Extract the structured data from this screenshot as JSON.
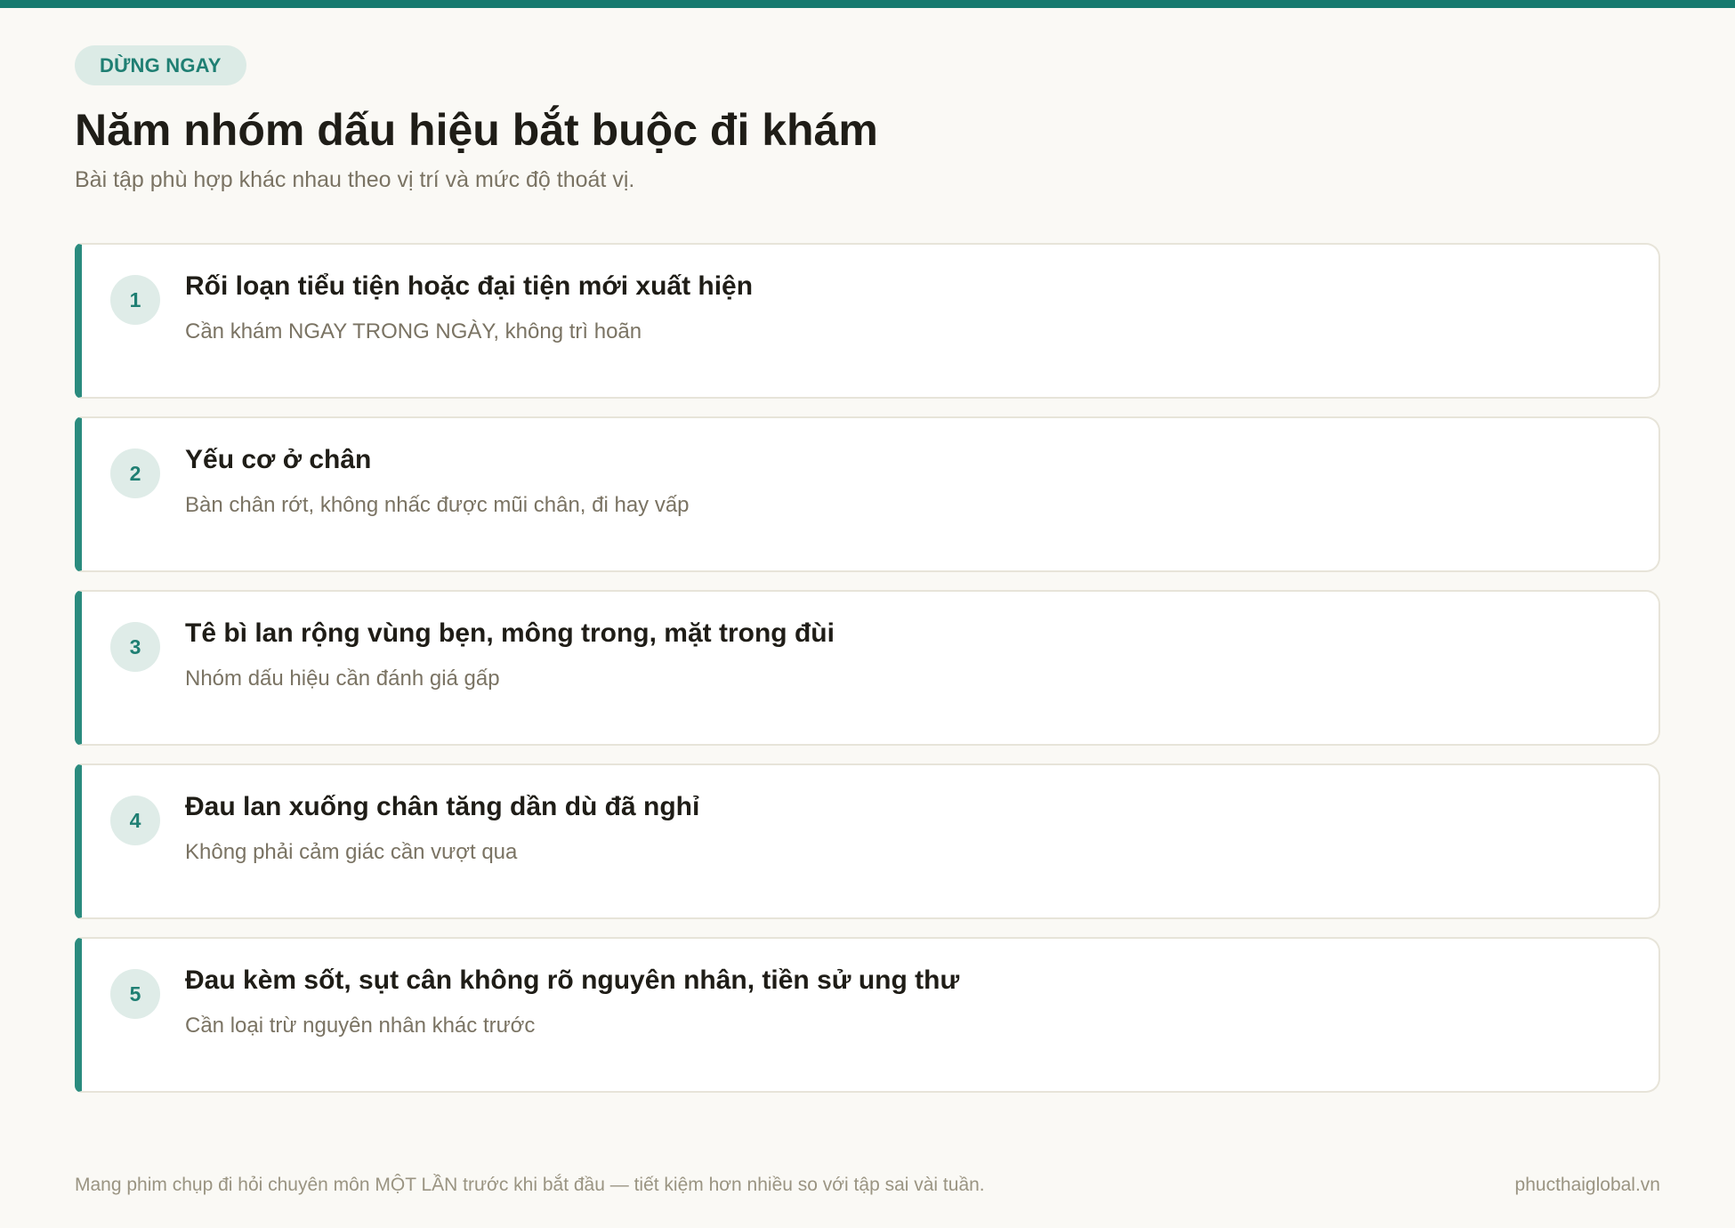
{
  "header": {
    "tag": "DỪNG NGAY",
    "title": "Năm nhóm dấu hiệu bắt buộc đi khám",
    "subtitle": "Bài tập phù hợp khác nhau theo vị trí và mức độ thoát vị."
  },
  "items": [
    {
      "number": "1",
      "title": "Rối loạn tiểu tiện hoặc đại tiện mới xuất hiện",
      "description": "Cần khám NGAY TRONG NGÀY, không trì hoãn"
    },
    {
      "number": "2",
      "title": "Yếu cơ ở chân",
      "description": "Bàn chân rớt, không nhấc được mũi chân, đi hay vấp"
    },
    {
      "number": "3",
      "title": "Tê bì lan rộng vùng bẹn, mông trong, mặt trong đùi",
      "description": "Nhóm dấu hiệu cần đánh giá gấp"
    },
    {
      "number": "4",
      "title": "Đau lan xuống chân tăng dần dù đã nghỉ",
      "description": "Không phải cảm giác cần vượt qua"
    },
    {
      "number": "5",
      "title": "Đau kèm sốt, sụt cân không rõ nguyên nhân, tiền sử ung thư",
      "description": "Cần loại trừ nguyên nhân khác trước"
    }
  ],
  "footer": {
    "note": "Mang phim chụp đi hỏi chuyên môn MỘT LẦN trước khi bắt đầu — tiết kiệm hơn nhiều so với tập sai vài tuần.",
    "brand": "phucthaiglobal.vn"
  },
  "colors": {
    "accent": "#177a6f",
    "background": "#faf9f5",
    "badge_bg": "#dcebe6"
  }
}
